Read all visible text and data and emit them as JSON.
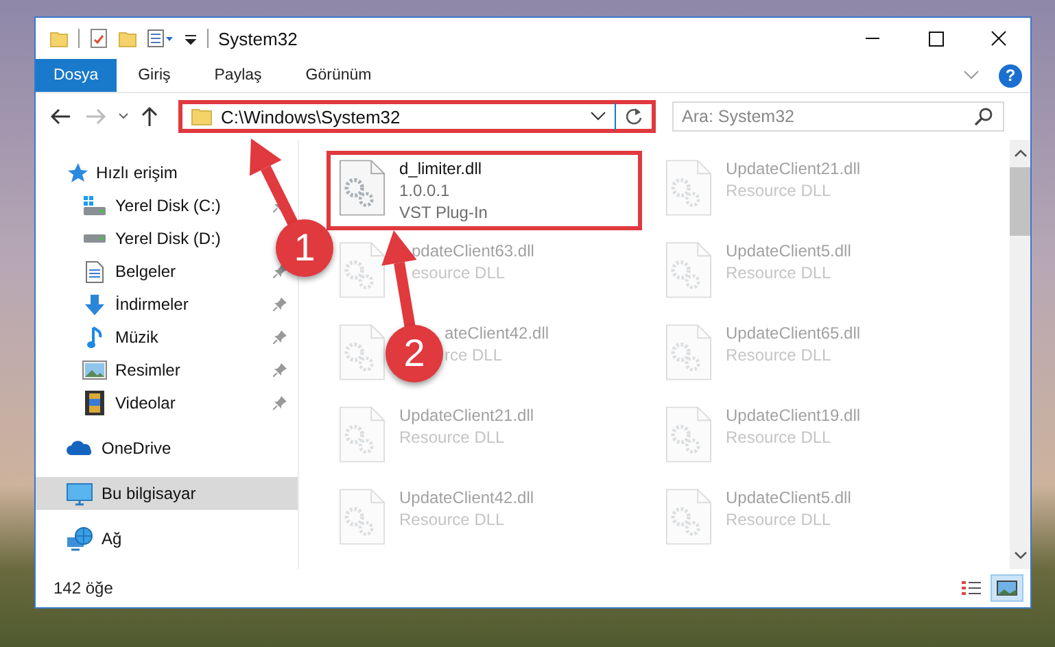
{
  "window": {
    "title": "System32"
  },
  "ribbon_tabs": [
    {
      "label": "Dosya",
      "selected": true
    },
    {
      "label": "Giriş",
      "selected": false
    },
    {
      "label": "Paylaş",
      "selected": false
    },
    {
      "label": "Görünüm",
      "selected": false
    }
  ],
  "help_button": {
    "label": "?"
  },
  "address_bar": {
    "path": "C:\\Windows\\System32",
    "highlighted": true
  },
  "search": {
    "placeholder": "Ara: System32"
  },
  "sidebar": {
    "items": [
      {
        "label": "Hızlı erişim",
        "kind": "quick_access",
        "selected": false,
        "children": [
          {
            "label": "Yerel Disk (C:)",
            "kind": "system_drive",
            "pinned": true,
            "selected": false
          },
          {
            "label": "Yerel Disk (D:)",
            "kind": "drive",
            "pinned": false,
            "selected": false
          },
          {
            "label": "Belgeler",
            "kind": "documents",
            "pinned": true,
            "selected": false
          },
          {
            "label": "İndirmeler",
            "kind": "downloads",
            "pinned": true,
            "selected": false
          },
          {
            "label": "Müzik",
            "kind": "music",
            "pinned": true,
            "selected": false
          },
          {
            "label": "Resimler",
            "kind": "pictures",
            "pinned": true,
            "selected": false
          },
          {
            "label": "Videolar",
            "kind": "videos",
            "pinned": true,
            "selected": false
          }
        ]
      },
      {
        "label": "OneDrive",
        "kind": "cloud",
        "selected": false
      },
      {
        "label": "Bu bilgisayar",
        "kind": "computer",
        "selected": true
      },
      {
        "label": "Ağ",
        "kind": "network",
        "selected": false
      }
    ]
  },
  "files": [
    {
      "name": "d_limiter.dll",
      "details": [
        "1.0.0.1",
        "VST Plug-In"
      ],
      "highlighted": true,
      "faded": false
    },
    {
      "name": "UpdateClient21.dll",
      "details": [
        "Resource DLL"
      ],
      "highlighted": false,
      "faded": true
    },
    {
      "name": "pdateClient63.dll",
      "details": [
        "esource DLL"
      ],
      "highlighted": false,
      "faded": true
    },
    {
      "name": "UpdateClient5.dll",
      "details": [
        "Resource DLL"
      ],
      "highlighted": false,
      "faded": true
    },
    {
      "name": "ateClient42.dll",
      "details": [
        "rce DLL"
      ],
      "highlighted": false,
      "faded": true
    },
    {
      "name": "UpdateClient65.dll",
      "details": [
        "Resource DLL"
      ],
      "highlighted": false,
      "faded": true
    },
    {
      "name": "UpdateClient21.dll",
      "details": [
        "Resource DLL"
      ],
      "highlighted": false,
      "faded": true
    },
    {
      "name": "UpdateClient19.dll",
      "details": [
        "Resource DLL"
      ],
      "highlighted": false,
      "faded": true
    },
    {
      "name": "UpdateClient42.dll",
      "details": [
        "Resource DLL"
      ],
      "highlighted": false,
      "faded": true
    },
    {
      "name": "UpdateClient5.dll",
      "details": [
        "Resource DLL"
      ],
      "highlighted": false,
      "faded": true
    }
  ],
  "annotations": [
    {
      "number": "1"
    },
    {
      "number": "2"
    }
  ],
  "status_bar": {
    "item_count": "142 öğe",
    "views": [
      {
        "kind": "details",
        "selected": false
      },
      {
        "kind": "large_icons",
        "selected": true
      }
    ]
  }
}
